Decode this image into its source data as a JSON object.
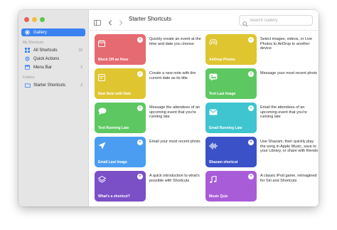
{
  "window": {
    "title": "Starter Shortcuts"
  },
  "search": {
    "placeholder": "Search Gallery"
  },
  "sidebar": {
    "gallery": {
      "label": "Gallery",
      "icon": "gallery-icon"
    },
    "my_shortcuts_header": "My Shortcuts",
    "items": [
      {
        "label": "All Shortcuts",
        "count": "10",
        "icon": "grid-icon"
      },
      {
        "label": "Quick Actions",
        "count": "",
        "icon": "gear-icon"
      },
      {
        "label": "Menu Bar",
        "count": "2",
        "icon": "menubar-icon"
      }
    ],
    "folders_header": "Folders",
    "folders": [
      {
        "label": "Starter Shortcuts",
        "count": "2",
        "icon": "folder-icon"
      }
    ]
  },
  "cards": [
    {
      "name": "Block Off an Hour",
      "desc": "Quickly create an event at the time and date you choose",
      "color": "#e66a72",
      "badge": "+",
      "icon": "calendar-icon"
    },
    {
      "name": "AirDrop Photos",
      "desc": "Select images, videos, or Live Photos to AirDrop to another device",
      "color": "#dfc530",
      "badge": "✓",
      "icon": "airdrop-icon"
    },
    {
      "name": "New Note with Date",
      "desc": "Create a new note with the current date as its title",
      "color": "#dfc530",
      "badge": "✓",
      "icon": "note-icon"
    },
    {
      "name": "Text Last Image",
      "desc": "Message your most recent photo",
      "color": "#5dc862",
      "badge": "+",
      "icon": "message-image-icon"
    },
    {
      "name": "Text Running Late",
      "desc": "Message the attendees of an upcoming event that you're running late",
      "color": "#5dc862",
      "badge": "+",
      "icon": "chat-bubble-icon"
    },
    {
      "name": "Email Running Late",
      "desc": "Email the attendees of an upcoming event that you're running late",
      "color": "#3fc5cf",
      "badge": "+",
      "icon": "envelope-icon"
    },
    {
      "name": "Email Last Image",
      "desc": "Email your most recent photo",
      "color": "#4a9df0",
      "badge": "+",
      "icon": "paperplane-icon"
    },
    {
      "name": "Shazam shortcut",
      "desc": "Use Shazam, then quickly play the song in Apple Music, save to your Library, or share with friends",
      "color": "#3b51c8",
      "badge": "+",
      "icon": "waveform-icon"
    },
    {
      "name": "What's a shortcut?",
      "desc": "A quick introduction to what's possible with Shortcuts",
      "color": "#7b4fc6",
      "badge": "+",
      "icon": "layers-icon"
    },
    {
      "name": "Music Quiz",
      "desc": "A classic iPod game, reimagined for Siri and Shortcuts",
      "color": "#a95cd8",
      "badge": "+",
      "icon": "music-note-icon"
    }
  ]
}
